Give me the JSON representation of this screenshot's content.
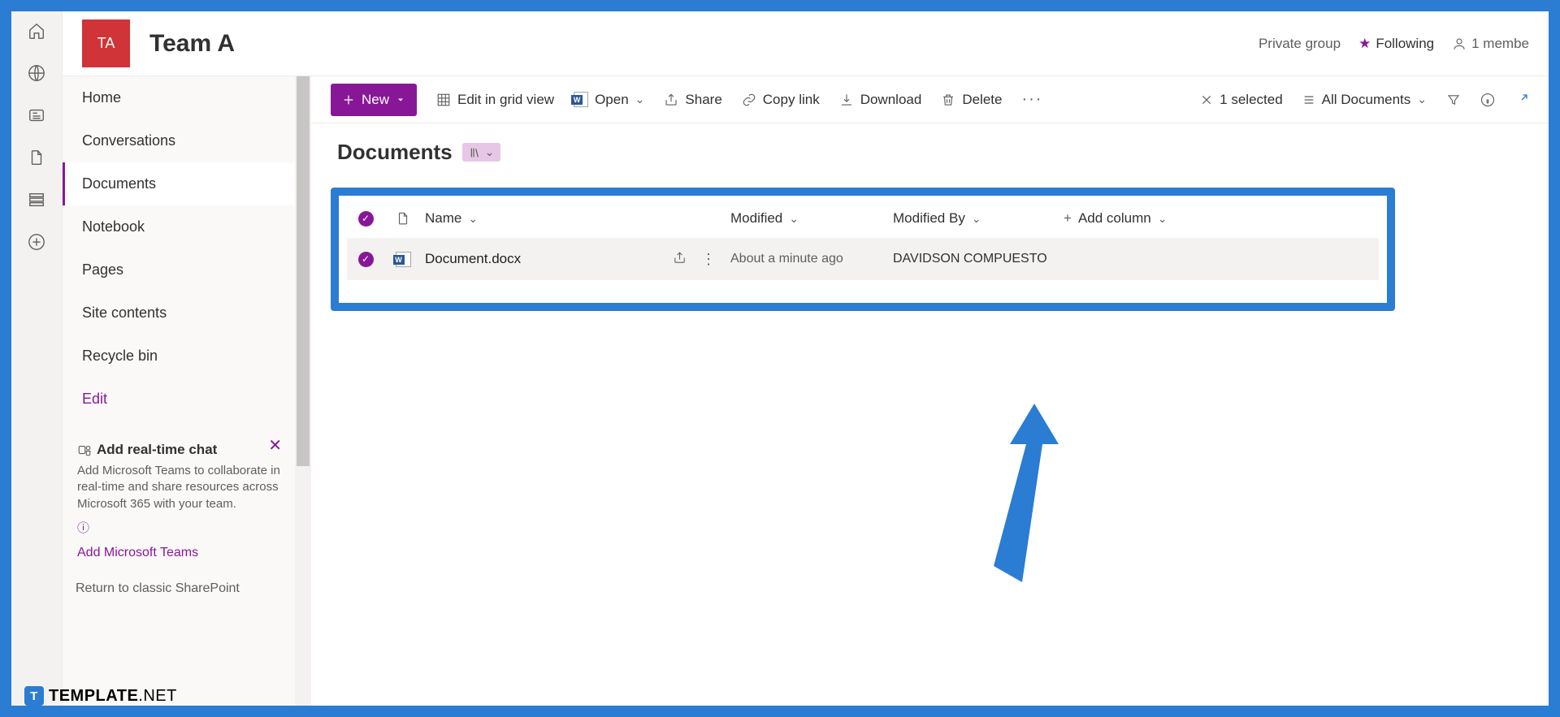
{
  "site": {
    "logo_initials": "TA",
    "title": "Team A",
    "privacy": "Private group",
    "following_label": "Following",
    "members_label": "1 membe"
  },
  "nav": {
    "items": [
      "Home",
      "Conversations",
      "Documents",
      "Notebook",
      "Pages",
      "Site contents",
      "Recycle bin"
    ],
    "edit_label": "Edit",
    "active_index": 2
  },
  "chat_promo": {
    "title": "Add real-time chat",
    "desc": "Add Microsoft Teams to collaborate in real-time and share resources across Microsoft 365 with your team.",
    "link": "Add Microsoft Teams"
  },
  "classic_link": "Return to classic SharePoint",
  "cmdbar": {
    "new": "New",
    "edit_grid": "Edit in grid view",
    "open": "Open",
    "share": "Share",
    "copy_link": "Copy link",
    "download": "Download",
    "delete": "Delete",
    "selected": "1 selected",
    "view": "All Documents"
  },
  "library": {
    "title": "Documents",
    "columns": {
      "name": "Name",
      "modified": "Modified",
      "modified_by": "Modified By",
      "add": "Add column"
    },
    "rows": [
      {
        "name": "Document.docx",
        "modified": "About a minute ago",
        "modified_by": "DAVIDSON COMPUESTO"
      }
    ]
  },
  "watermark": {
    "brand": "TEMPLATE",
    "suffix": ".NET"
  }
}
